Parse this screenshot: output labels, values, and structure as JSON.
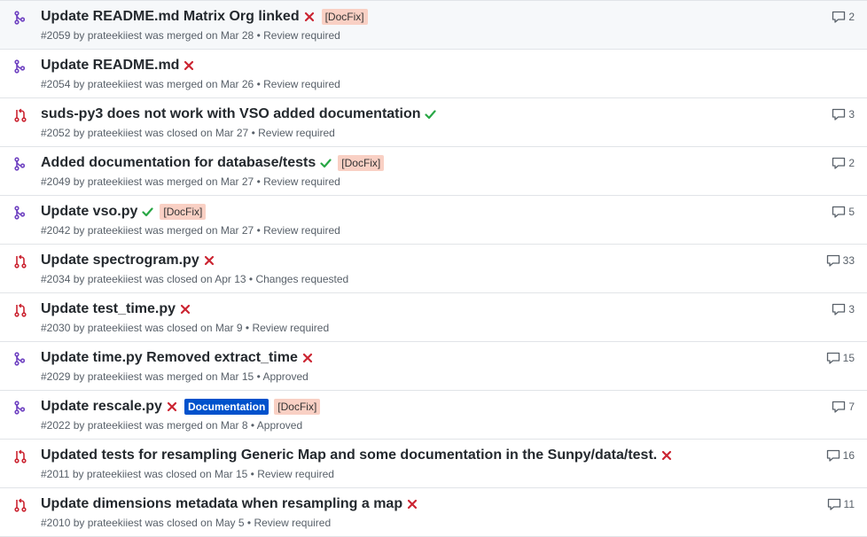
{
  "colors": {
    "merged": "#6f42c1",
    "closed": "#cb2431",
    "success": "#28a745",
    "failure": "#cb2431",
    "docfix_bg": "#f9d0c4",
    "documentation_bg": "#0052cc"
  },
  "pull_requests": [
    {
      "state": "merged",
      "state_icon": "git-merge-icon",
      "title": "Update README.md Matrix Org linked",
      "status": "failure",
      "status_icon": "x-icon",
      "labels": [
        {
          "text": "[DocFix]",
          "kind": "docfix"
        }
      ],
      "number": "#2059",
      "by": "by",
      "author": "prateekiiest",
      "action": "was merged on",
      "date": "Mar 28",
      "separator": "•",
      "review": "Review required",
      "comment_icon": "comment-icon",
      "comments": "2"
    },
    {
      "state": "merged",
      "state_icon": "git-merge-icon",
      "title": "Update README.md",
      "status": "failure",
      "status_icon": "x-icon",
      "labels": [],
      "number": "#2054",
      "by": "by",
      "author": "prateekiiest",
      "action": "was merged on",
      "date": "Mar 26",
      "separator": "•",
      "review": "Review required",
      "comments": ""
    },
    {
      "state": "closed",
      "state_icon": "git-pull-request-closed-icon",
      "title": "suds-py3 does not work with VSO added documentation",
      "status": "success",
      "status_icon": "check-icon",
      "labels": [],
      "number": "#2052",
      "by": "by",
      "author": "prateekiiest",
      "action": "was closed on",
      "date": "Mar 27",
      "separator": "•",
      "review": "Review required",
      "comment_icon": "comment-icon",
      "comments": "3"
    },
    {
      "state": "merged",
      "state_icon": "git-merge-icon",
      "title": "Added documentation for database/tests",
      "status": "success",
      "status_icon": "check-icon",
      "labels": [
        {
          "text": "[DocFix]",
          "kind": "docfix"
        }
      ],
      "number": "#2049",
      "by": "by",
      "author": "prateekiiest",
      "action": "was merged on",
      "date": "Mar 27",
      "separator": "•",
      "review": "Review required",
      "comment_icon": "comment-icon",
      "comments": "2"
    },
    {
      "state": "merged",
      "state_icon": "git-merge-icon",
      "title": "Update vso.py",
      "status": "success",
      "status_icon": "check-icon",
      "labels": [
        {
          "text": "[DocFix]",
          "kind": "docfix"
        }
      ],
      "number": "#2042",
      "by": "by",
      "author": "prateekiiest",
      "action": "was merged on",
      "date": "Mar 27",
      "separator": "•",
      "review": "Review required",
      "comment_icon": "comment-icon",
      "comments": "5"
    },
    {
      "state": "closed",
      "state_icon": "git-pull-request-closed-icon",
      "title": "Update spectrogram.py",
      "status": "failure",
      "status_icon": "x-icon",
      "labels": [],
      "number": "#2034",
      "by": "by",
      "author": "prateekiiest",
      "action": "was closed on",
      "date": "Apr 13",
      "separator": "•",
      "review": "Changes requested",
      "comment_icon": "comment-icon",
      "comments": "33"
    },
    {
      "state": "closed",
      "state_icon": "git-pull-request-closed-icon",
      "title": "Update test_time.py",
      "status": "failure",
      "status_icon": "x-icon",
      "labels": [],
      "number": "#2030",
      "by": "by",
      "author": "prateekiiest",
      "action": "was closed on",
      "date": "Mar 9",
      "separator": "•",
      "review": "Review required",
      "comment_icon": "comment-icon",
      "comments": "3"
    },
    {
      "state": "merged",
      "state_icon": "git-merge-icon",
      "title": "Update time.py Removed extract_time",
      "status": "failure",
      "status_icon": "x-icon",
      "labels": [],
      "number": "#2029",
      "by": "by",
      "author": "prateekiiest",
      "action": "was merged on",
      "date": "Mar 15",
      "separator": "•",
      "review": "Approved",
      "comment_icon": "comment-icon",
      "comments": "15"
    },
    {
      "state": "merged",
      "state_icon": "git-merge-icon",
      "title": "Update rescale.py",
      "status": "failure",
      "status_icon": "x-icon",
      "labels": [
        {
          "text": "Documentation",
          "kind": "documentation"
        },
        {
          "text": "[DocFix]",
          "kind": "docfix"
        }
      ],
      "number": "#2022",
      "by": "by",
      "author": "prateekiiest",
      "action": "was merged on",
      "date": "Mar 8",
      "separator": "•",
      "review": "Approved",
      "comment_icon": "comment-icon",
      "comments": "7"
    },
    {
      "state": "closed",
      "state_icon": "git-pull-request-closed-icon",
      "title": "Updated tests for resampling Generic Map and some documentation in the Sunpy/data/test.",
      "status": "failure",
      "status_icon": "x-icon",
      "labels": [],
      "number": "#2011",
      "by": "by",
      "author": "prateekiiest",
      "action": "was closed on",
      "date": "Mar 15",
      "separator": "•",
      "review": "Review required",
      "comment_icon": "comment-icon",
      "comments": "16"
    },
    {
      "state": "closed",
      "state_icon": "git-pull-request-closed-icon",
      "title": "Update dimensions metadata when resampling a map",
      "status": "failure",
      "status_icon": "x-icon",
      "labels": [],
      "number": "#2010",
      "by": "by",
      "author": "prateekiiest",
      "action": "was closed on",
      "date": "May 5",
      "separator": "•",
      "review": "Review required",
      "comment_icon": "comment-icon",
      "comments": "11"
    }
  ]
}
